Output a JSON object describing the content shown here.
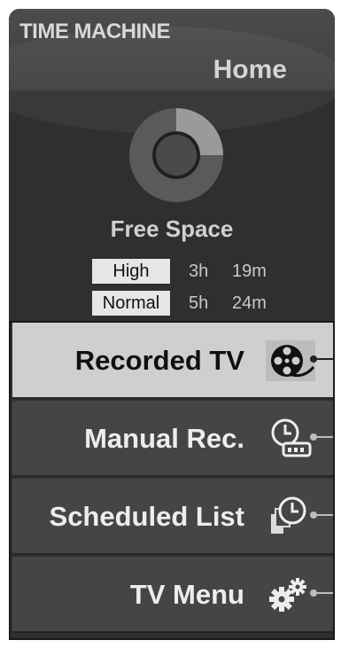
{
  "header": {
    "brand": "TIME MACHINE",
    "title": "Home"
  },
  "storage": {
    "label": "Free Space",
    "used_fraction": 0.25,
    "rows": [
      {
        "quality": "High",
        "hours": "3h",
        "minutes": "19m"
      },
      {
        "quality": "Normal",
        "hours": "5h",
        "minutes": "24m"
      }
    ]
  },
  "menu": {
    "selected_index": 0,
    "items": [
      {
        "label": "Recorded TV",
        "icon": "film-reel-icon"
      },
      {
        "label": "Manual Rec.",
        "icon": "clock-record-icon"
      },
      {
        "label": "Scheduled List",
        "icon": "schedule-clock-icon"
      },
      {
        "label": "TV Menu",
        "icon": "gears-icon"
      }
    ]
  },
  "colors": {
    "panel": "#2f2f2f",
    "menu_item": "#454545",
    "menu_item_selected": "#cfcfcf",
    "donut_track": "#5a5a5a",
    "donut_fill": "#9a9a9a"
  }
}
